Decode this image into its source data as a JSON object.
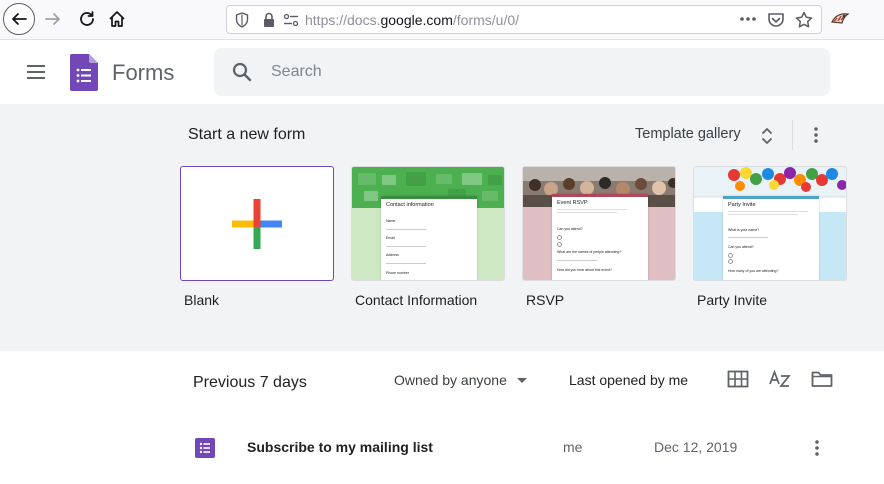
{
  "browser": {
    "url_prefix": "https://docs.",
    "url_host": "google.com",
    "url_suffix": "/forms/u/0/"
  },
  "header": {
    "app_name": "Forms",
    "search_placeholder": "Search"
  },
  "templates": {
    "section_title": "Start a new form",
    "gallery_label": "Template gallery",
    "items": [
      {
        "label": "Blank"
      },
      {
        "label": "Contact Information",
        "preview_title": "Contact information",
        "fields": [
          "Name",
          "Email",
          "Address",
          "Phone number"
        ]
      },
      {
        "label": "RSVP",
        "preview_title": "Event RSVP",
        "questions": [
          "Can you attend?",
          "What are the names of people attending?",
          "How did you hear about this event?"
        ]
      },
      {
        "label": "Party Invite",
        "preview_title": "Party Invite",
        "questions": [
          "What is your name?",
          "Can you attend?",
          "How many of you are attending?"
        ]
      }
    ]
  },
  "recent": {
    "title": "Previous 7 days",
    "owner_filter": "Owned by anyone",
    "sort_label": "Last opened by me",
    "rows": [
      {
        "title": "Subscribe to my mailing list",
        "owner": "me",
        "date": "Dec 12, 2019"
      }
    ]
  },
  "colors": {
    "forms_purple": "#7248b9",
    "google_red": "#ea4335",
    "google_blue": "#4285f4",
    "google_green": "#34a853",
    "google_yellow": "#fbbc05",
    "template_bg": "#f1f3f4"
  }
}
